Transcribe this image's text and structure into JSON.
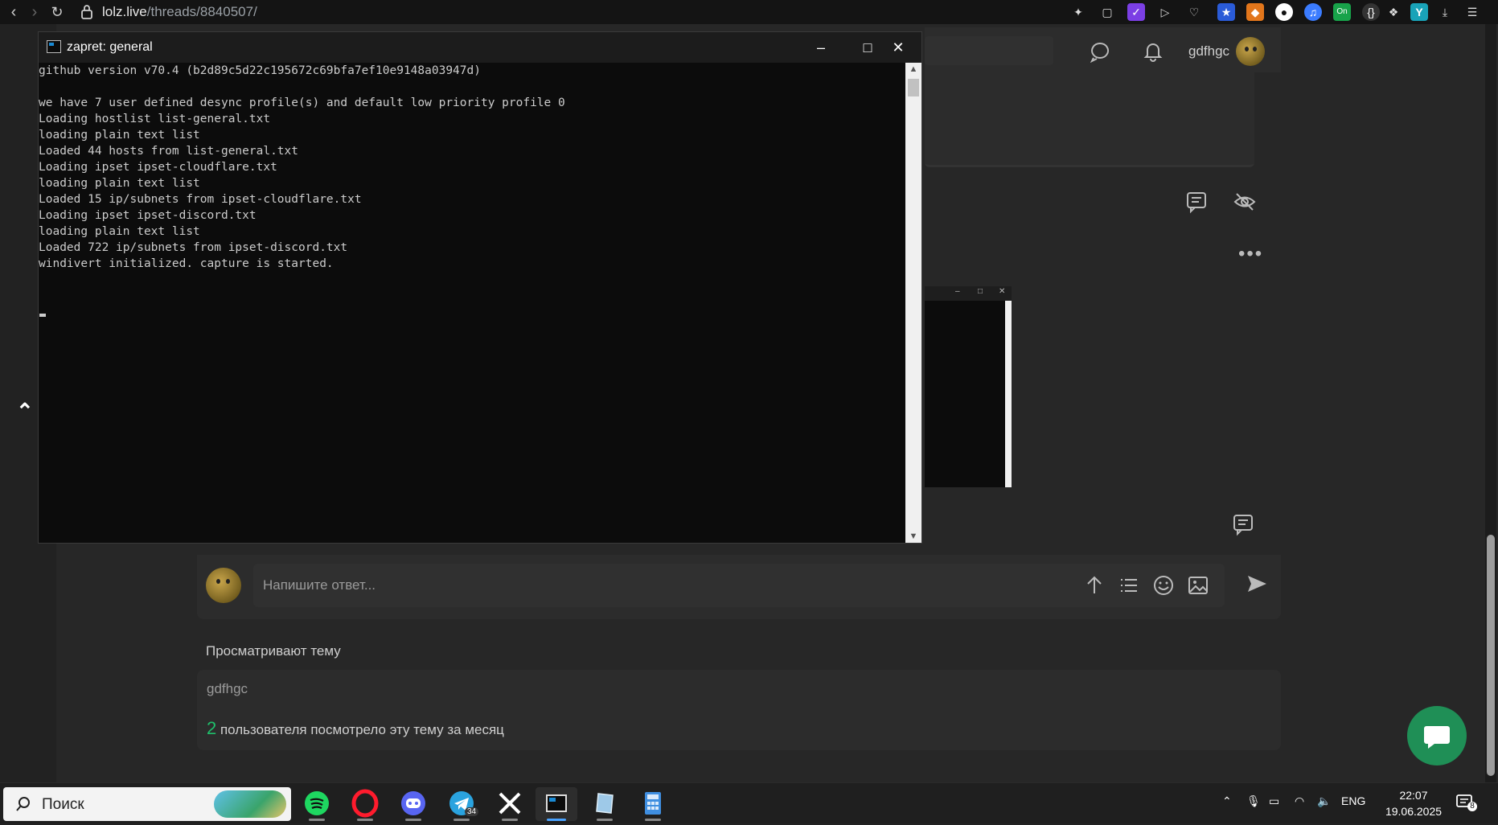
{
  "browser": {
    "url_host": "lolz.live",
    "url_path": "/threads/8840507/"
  },
  "forum": {
    "username": "gdfhgc",
    "reply_placeholder": "Напишите ответ...",
    "viewers_title": "Просматривают тему",
    "viewers": [
      "gdfhgc"
    ],
    "monthly_count": "2",
    "monthly_text": " пользователя посмотрело эту тему за месяц",
    "accent_color": "#1fbf6b"
  },
  "console": {
    "title": "zapret: general",
    "lines": [
      "github version v70.4 (b2d89c5d22c195672c69bfa7ef10e9148a03947d)",
      "",
      "we have 7 user defined desync profile(s) and default low priority profile 0",
      "Loading hostlist list-general.txt",
      "loading plain text list",
      "Loaded 44 hosts from list-general.txt",
      "Loading ipset ipset-cloudflare.txt",
      "loading plain text list",
      "Loaded 15 ip/subnets from ipset-cloudflare.txt",
      "Loading ipset ipset-discord.txt",
      "loading plain text list",
      "Loaded 722 ip/subnets from ipset-discord.txt",
      "windivert initialized. capture is started."
    ]
  },
  "taskbar": {
    "search_label": "Поиск",
    "telegram_badge": "34",
    "lang": "ENG",
    "time": "22:07",
    "date": "19.06.2025",
    "notification_count": "8"
  }
}
